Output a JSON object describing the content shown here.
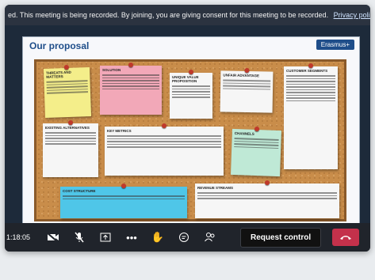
{
  "banner": {
    "text": "ed. This meeting is being recorded. By joining, you are giving consent for this meeting to be recorded.",
    "link": "Privacy policy"
  },
  "slide": {
    "title": "Our proposal",
    "logo": "Erasmus+",
    "notes": [
      {
        "heading": "Threats and matters",
        "color": "#f4ee8a"
      },
      {
        "heading": "Solution",
        "color": "#f2a8b8"
      },
      {
        "heading": "Unique value proposition",
        "color": "#f6f6f6"
      },
      {
        "heading": "Unfair advantage",
        "color": "#f6f6f6"
      },
      {
        "heading": "Customer segments",
        "color": "#f6f6f6"
      },
      {
        "heading": "Existing alternatives",
        "color": "#f6f6f6"
      },
      {
        "heading": "Key metrics",
        "color": "#f6f6f6"
      },
      {
        "heading": "Channels",
        "color": "#bfe9d6"
      },
      {
        "heading": "Cost structure",
        "color": "#4fc6e8"
      },
      {
        "heading": "Revenue streams",
        "color": "#f6f6f6"
      }
    ]
  },
  "toolbar": {
    "time": "1:18:05",
    "icons": [
      "camera-off-icon",
      "mic-off-icon",
      "share-icon",
      "more-icon",
      "raise-hand-icon",
      "chat-icon",
      "participants-icon"
    ],
    "request_control": "Request control",
    "hangup_color": "#c4314b"
  }
}
